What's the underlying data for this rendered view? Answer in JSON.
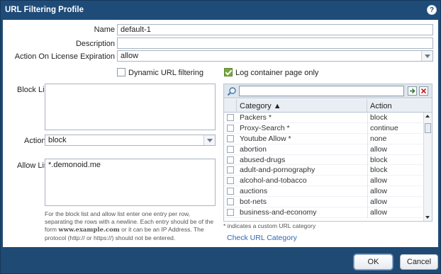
{
  "window": {
    "title": "URL Filtering Profile",
    "help_icon": "?"
  },
  "form": {
    "name_label": "Name",
    "name_value": "default-1",
    "description_label": "Description",
    "description_value": "",
    "expiration_label": "Action On License Expiration",
    "expiration_value": "allow",
    "dynamic_label": "Dynamic URL filtering",
    "dynamic_checked": false,
    "log_label": "Log container page only",
    "log_checked": true,
    "block_list_label": "Block List",
    "block_list_value": "",
    "action_label": "Action",
    "action_value": "block",
    "allow_list_label": "Allow List",
    "allow_list_value": "*.demonoid.me",
    "help_text_1": "For the block list and allow list enter one entry per row, separating the rows with a newline. Each entry should be of the form ",
    "help_text_example": "www.example.com",
    "help_text_2": " or it can be an IP Address. The protocol (http:// or https://) should not be entered."
  },
  "category_table": {
    "search_placeholder": "",
    "headers": {
      "category": "Category ▲",
      "action": "Action"
    },
    "rows": [
      {
        "category": "Packers *",
        "action": "block"
      },
      {
        "category": "Proxy-Search *",
        "action": "continue"
      },
      {
        "category": "Youtube Allow *",
        "action": "none"
      },
      {
        "category": "abortion",
        "action": "allow"
      },
      {
        "category": "abused-drugs",
        "action": "block"
      },
      {
        "category": "adult-and-pornography",
        "action": "block"
      },
      {
        "category": "alcohol-and-tobacco",
        "action": "allow"
      },
      {
        "category": "auctions",
        "action": "allow"
      },
      {
        "category": "bot-nets",
        "action": "allow"
      },
      {
        "category": "business-and-economy",
        "action": "allow"
      }
    ],
    "custom_note": "* indicates a custom URL category",
    "check_link": "Check URL Category"
  },
  "footer": {
    "ok_label": "OK",
    "cancel_label": "Cancel"
  },
  "colors": {
    "titlebar": "#1f4b78",
    "link": "#2a6ab5",
    "checked": "#7aa63f"
  }
}
